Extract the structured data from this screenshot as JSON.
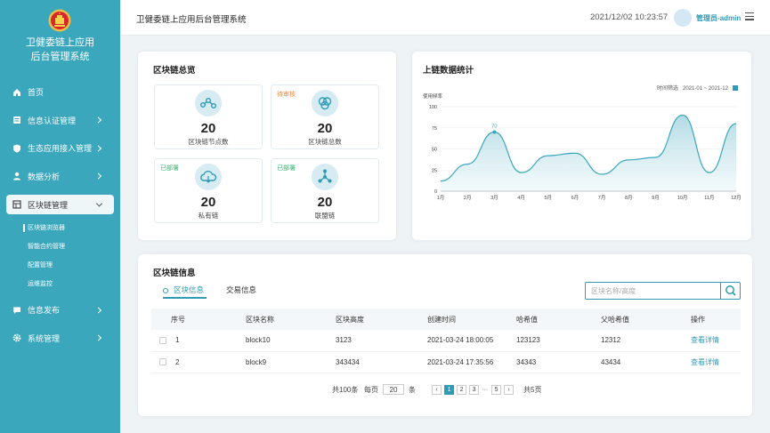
{
  "app": {
    "name_line1": "卫健委链上应用",
    "name_line2": "后台管理系统"
  },
  "sidebar": {
    "items": [
      {
        "label": "首页",
        "icon": "home-icon"
      },
      {
        "label": "信息认证管理",
        "icon": "document-icon"
      },
      {
        "label": "生态应用接入管理",
        "icon": "shield-icon"
      },
      {
        "label": "数据分析",
        "icon": "user-icon"
      },
      {
        "label": "区块链管理",
        "icon": "table-icon"
      },
      {
        "label": "信息发布",
        "icon": "message-icon"
      },
      {
        "label": "系统管理",
        "icon": "gear-icon"
      }
    ],
    "sub_items": [
      "区块链浏览器",
      "智能合约管理",
      "配置管理",
      "运维监控"
    ]
  },
  "header": {
    "title": "卫健委链上应用后台管理系统",
    "datetime": "2021/12/02 10:23:57",
    "user": "管理员-admin"
  },
  "overview": {
    "title": "区块链总览",
    "stats": [
      {
        "badge": "",
        "value": "20",
        "label": "区块链节点数",
        "icon": "nodes-icon"
      },
      {
        "badge": "待审核",
        "value": "20",
        "label": "区块链总数",
        "icon": "hexagon-icon"
      },
      {
        "badge": "已部署",
        "value": "20",
        "label": "私有链",
        "icon": "cloud-icon"
      },
      {
        "badge": "已部署",
        "value": "20",
        "label": "联盟链",
        "icon": "network-icon"
      }
    ],
    "colors": {
      "pending": "#f08a3c",
      "deployed": "#3cb371",
      "accent": "#2f9bb5"
    }
  },
  "stats_chart": {
    "title": "上链数据统计",
    "filter_label": "时间筛选",
    "filter_value": "2021-01 ~ 2021-12"
  },
  "chart_data": {
    "type": "area",
    "title": "上链数据统计",
    "ylabel": "使用频率",
    "categories": [
      "1月",
      "2月",
      "3月",
      "4月",
      "5月",
      "6月",
      "7月",
      "8月",
      "9月",
      "10月",
      "11月",
      "12月"
    ],
    "values": [
      12,
      32,
      70,
      22,
      42,
      45,
      20,
      37,
      40,
      90,
      22,
      80
    ],
    "highlight": {
      "category": "3月",
      "label": "70"
    },
    "ylim": [
      0,
      100
    ],
    "yticks": [
      0,
      25,
      50,
      75,
      100
    ],
    "grid": true
  },
  "blocks": {
    "title": "区块链信息",
    "tabs": [
      "区块信息",
      "交易信息"
    ],
    "search_placeholder": "区块名称/高度",
    "columns": [
      "序号",
      "区块名称",
      "区块高度",
      "创建时间",
      "哈希值",
      "父哈希值",
      "操作"
    ],
    "rows": [
      {
        "no": "1",
        "name": "block10",
        "height": "3123",
        "time": "2021-03-24 18:00:05",
        "hash": "123123",
        "parent": "12312",
        "action": "查看详情"
      },
      {
        "no": "2",
        "name": "block9",
        "height": "343434",
        "time": "2021-03-24 17:35:56",
        "hash": "34343",
        "parent": "43434",
        "action": "查看详情"
      }
    ],
    "pager": {
      "total": "共100条",
      "per_page_label": "每页",
      "per_page": "20",
      "unit": "条",
      "pages": [
        "1",
        "2",
        "3",
        "···",
        "5"
      ],
      "total_pages": "共5页"
    }
  }
}
